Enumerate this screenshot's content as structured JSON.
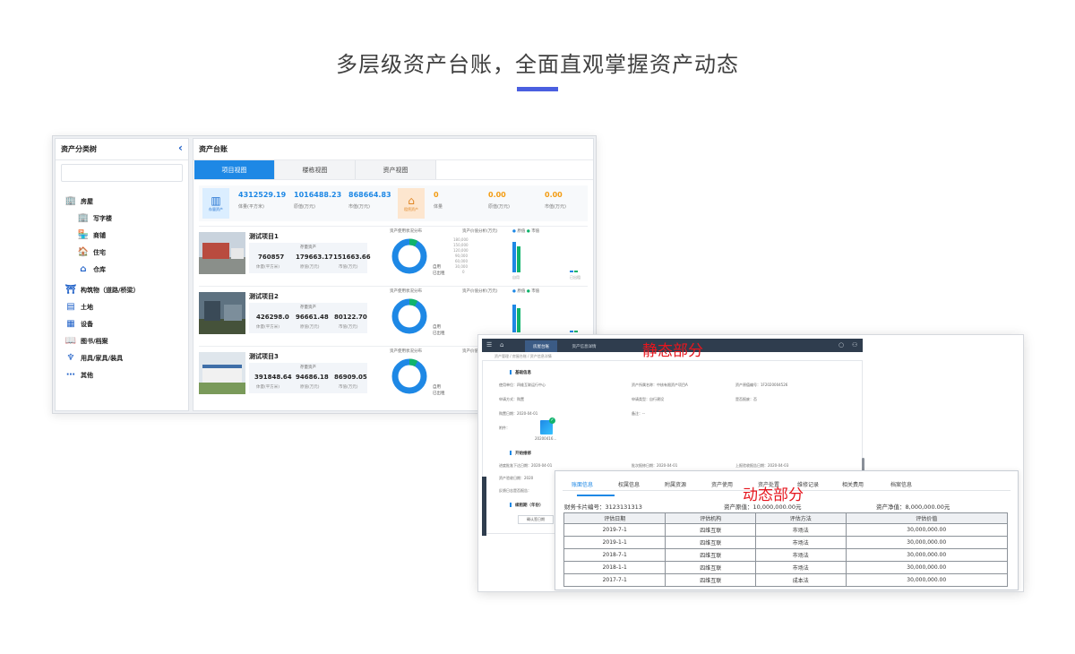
{
  "headline": "多层级资产台账，全面直观掌握资产动态",
  "colors": {
    "accent": "#4a5fe0",
    "primary": "#1e88e5",
    "green": "#10b36c",
    "warning": "#f39c12",
    "annotation_red": "#e6161e"
  },
  "tree": {
    "title": "资产分类树",
    "collapse_icon": "chevron-left-icon",
    "items": [
      {
        "label": "房屋",
        "icon": "building-icon",
        "level": 0
      },
      {
        "label": "写字楼",
        "icon": "office-icon",
        "level": 1
      },
      {
        "label": "商铺",
        "icon": "shop-icon",
        "level": 1
      },
      {
        "label": "住宅",
        "icon": "house-icon",
        "level": 1
      },
      {
        "label": "仓库",
        "icon": "warehouse-icon",
        "level": 1
      },
      {
        "label": "构筑物（道路/桥梁）",
        "icon": "bridge-icon",
        "level": 0
      },
      {
        "label": "土地",
        "icon": "land-icon",
        "level": 0
      },
      {
        "label": "设备",
        "icon": "equipment-icon",
        "level": 0
      },
      {
        "label": "图书/档案",
        "icon": "book-icon",
        "level": 0
      },
      {
        "label": "用具/家具/装具",
        "icon": "furniture-icon",
        "level": 0
      },
      {
        "label": "其他",
        "icon": "more-icon",
        "level": 0
      }
    ]
  },
  "ledger": {
    "title": "资产台账",
    "tabs": [
      "项目视图",
      "楼栋视图",
      "资产视图"
    ],
    "summary": {
      "owned_label": "存量资产",
      "owned_values": [
        "4312529.19",
        "1016488.23",
        "868664.83"
      ],
      "owned_units": [
        "体量(平方米)",
        "原值(万元)",
        "市值(万元)"
      ],
      "leased_label": "租赁资产",
      "leased_values": [
        "0",
        "0.00",
        "0.00"
      ],
      "leased_units": [
        "体量",
        "原值(万元)",
        "市值(万元)"
      ]
    },
    "projects": [
      {
        "name": "测试项目1",
        "caption": "存量资产",
        "values": [
          "760857",
          "179663.17",
          "151663.66"
        ],
        "units": [
          "体量(平方米)",
          "原值(万元)",
          "市值(万元)"
        ],
        "usage_ratio": 0.08
      },
      {
        "name": "测试项目2",
        "caption": "存量资产",
        "values": [
          "426298.0",
          "96661.48",
          "80122.70"
        ],
        "units": [
          "体量(平方米)",
          "原值(万元)",
          "市值(万元)"
        ],
        "usage_ratio": 0.08
      },
      {
        "name": "测试项目3",
        "caption": "存量资产",
        "values": [
          "391848.64",
          "94686.18",
          "86909.05"
        ],
        "units": [
          "体量(平方米)",
          "原值(万元)",
          "市值(万元)"
        ],
        "usage_ratio": 0.08
      }
    ],
    "donut_title": "资产使用状况分布",
    "donut_legend": [
      "自用",
      "已出租"
    ],
    "bar_title": "资产价值分析(万元)",
    "bar_legend": [
      "原值",
      "市值"
    ],
    "bar_categories": [
      "自用",
      "已出租"
    ],
    "bar_ticks": [
      "180,000",
      "150,000",
      "120,000",
      "90,000",
      "60,000",
      "30,000",
      "0"
    ]
  },
  "detail": {
    "annotation_static": "静态部分",
    "annotation_dynamic": "动态部分",
    "top_tabs": [
      "房屋台账",
      "资产信息详情"
    ],
    "breadcrumb": "资产管理 / 房屋台账 / 资产信息详情",
    "section_basic": "基础信息",
    "basic_fields": [
      "使用单位：四维互联运行中心",
      "资产所属名称：中核有限资产项目A",
      "资产原值编号：1F2020004526",
      "申请方式：购置",
      "申请类型：自行建设",
      "是否报废：否",
      "购置日期：2020-04-01",
      "备注：--",
      "附件："
    ],
    "file_name": "20200416...",
    "section_repair": "开始维修",
    "repair_fields": [
      "进度批准下达日期：2020-04-01",
      "批次报修日期：2020-04-01",
      "上报验收报告日期：2020-04-03",
      "资产验收日期：2020",
      "反馈日志是否报告："
    ],
    "section_lease": "续租期（年份）",
    "confirm_button": "确认签日期",
    "dynamic": {
      "tabs": [
        "账面信息",
        "权属信息",
        "附属资源",
        "资产使用",
        "资产处置",
        "维修记录",
        "相关费用",
        "档案信息"
      ],
      "card_no_label": "财务卡片编号：3123131313",
      "original_value": "资产原值：10,000,000.00元",
      "net_value": "资产净值：8,000,000.00元",
      "columns": [
        "评估日期",
        "评估机构",
        "评估方法",
        "评估价值"
      ],
      "rows": [
        [
          "2019-7-1",
          "四维互联",
          "市场法",
          "30,000,000.00"
        ],
        [
          "2019-1-1",
          "四维互联",
          "市场法",
          "30,000,000.00"
        ],
        [
          "2018-7-1",
          "四维互联",
          "市场法",
          "30,000,000.00"
        ],
        [
          "2018-1-1",
          "四维互联",
          "市场法",
          "30,000,000.00"
        ],
        [
          "2017-7-1",
          "四维互联",
          "成本法",
          "30,000,000.00"
        ]
      ]
    }
  }
}
